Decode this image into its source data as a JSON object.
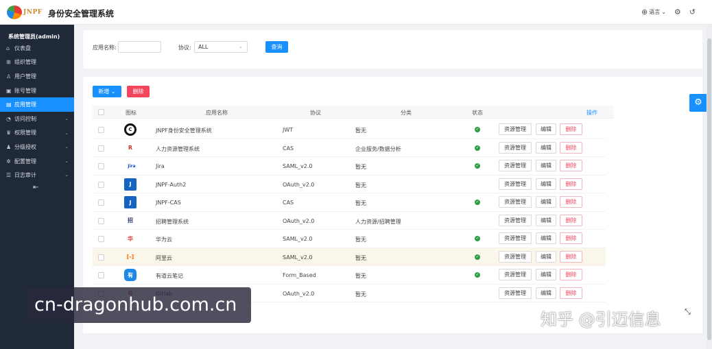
{
  "header": {
    "logo_text": "JNPF",
    "title": "身份安全管理系统",
    "language_label": "语言",
    "icons": [
      "globe-icon",
      "settings-icon",
      "power-icon"
    ]
  },
  "sidebar": {
    "user": "系统管理员(admin)",
    "items": [
      {
        "label": "仪表盘",
        "icon": "home-icon"
      },
      {
        "label": "组织管理",
        "icon": "org-icon"
      },
      {
        "label": "用户管理",
        "icon": "user-icon"
      },
      {
        "label": "账号管理",
        "icon": "account-icon"
      },
      {
        "label": "应用管理",
        "icon": "app-icon",
        "active": true
      },
      {
        "label": "访问控制",
        "icon": "access-icon",
        "has_children": true
      },
      {
        "label": "权限管理",
        "icon": "permission-icon",
        "has_children": true
      },
      {
        "label": "分级授权",
        "icon": "grant-icon",
        "has_children": true
      },
      {
        "label": "配置管理",
        "icon": "config-icon",
        "has_children": true
      },
      {
        "label": "日志审计",
        "icon": "log-icon",
        "has_children": true
      }
    ],
    "collapse_icon": "menu-fold-icon"
  },
  "search": {
    "app_name_label": "应用名称:",
    "app_name_value": "",
    "protocol_label": "协议:",
    "protocol_value": "ALL",
    "query_label": "查询"
  },
  "toolbar": {
    "add_label": "新增",
    "delete_label": "删除"
  },
  "table": {
    "columns": [
      "图标",
      "应用名称",
      "协议",
      "分类",
      "状态",
      "操作"
    ],
    "op_labels": {
      "resource": "资源管理",
      "edit": "编辑",
      "delete": "删除"
    },
    "rows": [
      {
        "name": "JNPF身份安全管理系统",
        "protocol": "JWT",
        "category": "暂无",
        "enabled": true,
        "icon": "C",
        "icon_color": "#111111"
      },
      {
        "name": "人力资源管理系统",
        "protocol": "CAS",
        "category": "企业服务/数据分析",
        "enabled": true,
        "icon": "R",
        "icon_color": "#c0392b"
      },
      {
        "name": "Jira",
        "protocol": "SAML_v2.0",
        "category": "暂无",
        "enabled": true,
        "icon": "Jira",
        "icon_color": "#0052cc"
      },
      {
        "name": "JNPF-Auth2",
        "protocol": "OAuth_v2.0",
        "category": "暂无",
        "enabled": false,
        "icon": "J",
        "icon_color": "#1565c0"
      },
      {
        "name": "JNPF-CAS",
        "protocol": "CAS",
        "category": "暂无",
        "enabled": true,
        "icon": "J",
        "icon_color": "#1565c0"
      },
      {
        "name": "招聘管理系统",
        "protocol": "OAuth_v2.0",
        "category": "人力资源/招聘管理",
        "enabled": false,
        "icon": "招",
        "icon_color": "#2c3e70"
      },
      {
        "name": "华为云",
        "protocol": "SAML_v2.0",
        "category": "暂无",
        "enabled": true,
        "icon": "华",
        "icon_color": "#e53935"
      },
      {
        "name": "阿里云",
        "protocol": "SAML_v2.0",
        "category": "暂无",
        "enabled": true,
        "icon": "[-]",
        "icon_color": "#ff6a00",
        "highlight": true
      },
      {
        "name": "有道云笔记",
        "protocol": "Form_Based",
        "category": "暂无",
        "enabled": true,
        "icon": "有",
        "icon_color": "#1e88e5"
      },
      {
        "name": "Gitlab",
        "protocol": "OAuth_v2.0",
        "category": "暂无",
        "enabled": false,
        "icon": "G",
        "icon_color": "#e2432a"
      }
    ]
  },
  "watermark": {
    "left": "cn-dragonhub.com.cn",
    "right": "知乎 @引迈信息"
  },
  "colors": {
    "primary": "#1890ff",
    "danger": "#f5455c",
    "sidebar_bg": "#1f2937",
    "status_ok": "#2e9e44"
  }
}
